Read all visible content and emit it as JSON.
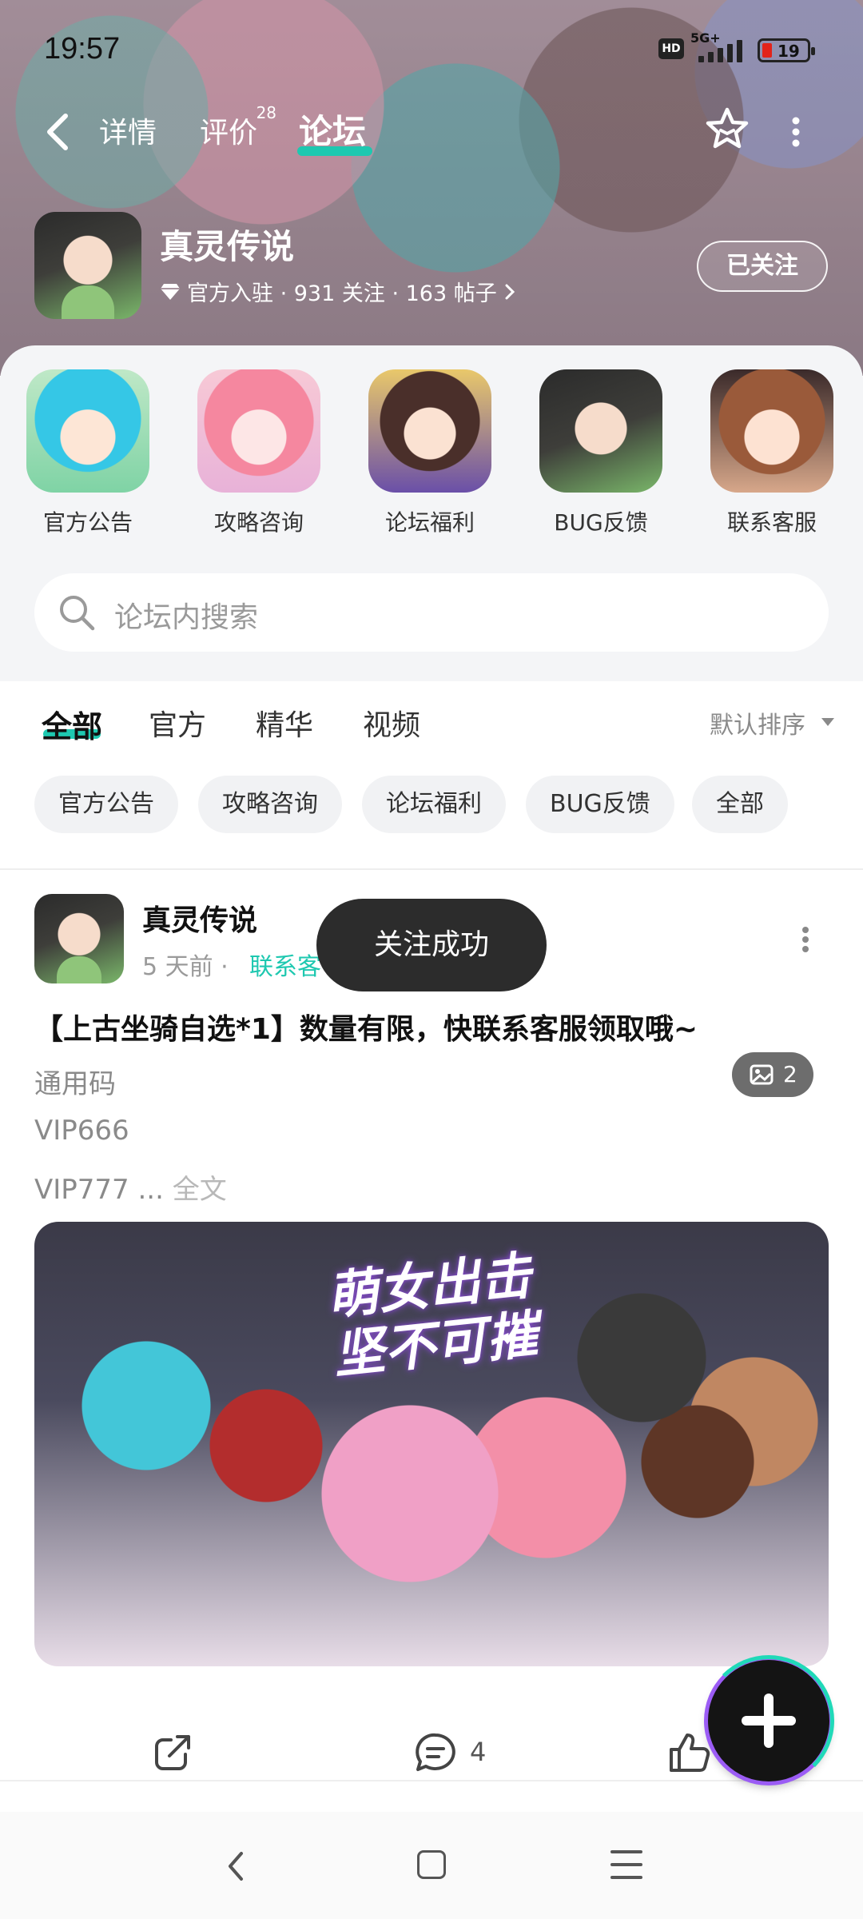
{
  "status_bar": {
    "time": "19:57",
    "network": "5G+",
    "battery": "19",
    "hd": "HD"
  },
  "nav": {
    "tabs": [
      {
        "label": "详情"
      },
      {
        "label": "评价",
        "badge": "28"
      },
      {
        "label": "论坛",
        "active": true
      }
    ]
  },
  "game": {
    "name": "真灵传说",
    "meta": "官方入驻 · 931 关注 · 163 帖子",
    "follow_label": "已关注"
  },
  "categories": [
    {
      "label": "官方公告",
      "color": "#3fc4e0"
    },
    {
      "label": "攻略咨询",
      "color": "#f38fa8"
    },
    {
      "label": "论坛福利",
      "color": "#6a4fa8"
    },
    {
      "label": "BUG反馈",
      "color": "#7ab76a"
    },
    {
      "label": "联系客服",
      "color": "#a0684a"
    }
  ],
  "search": {
    "placeholder": "论坛内搜索"
  },
  "filter_tabs": [
    {
      "label": "全部",
      "active": true
    },
    {
      "label": "官方"
    },
    {
      "label": "精华"
    },
    {
      "label": "视频"
    }
  ],
  "sort_label": "默认排序",
  "chips": [
    "官方公告",
    "攻略咨询",
    "论坛福利",
    "BUG反馈",
    "全部"
  ],
  "post": {
    "author": "真灵传说",
    "time": "5 天前",
    "separator": "·",
    "tag": "联系客",
    "title": "【上古坐骑自选*1】数量有限，快联系客服领取哦~",
    "lines": [
      "通用码",
      "VIP666",
      "VIP777 ..."
    ],
    "full_text_label": "全文",
    "banner_text_1": "萌女出击",
    "banner_text_2": "坚不可摧",
    "image_count": "2",
    "comment_count": "4"
  },
  "toast": "关注成功",
  "accent_color": "#1ec8b0"
}
